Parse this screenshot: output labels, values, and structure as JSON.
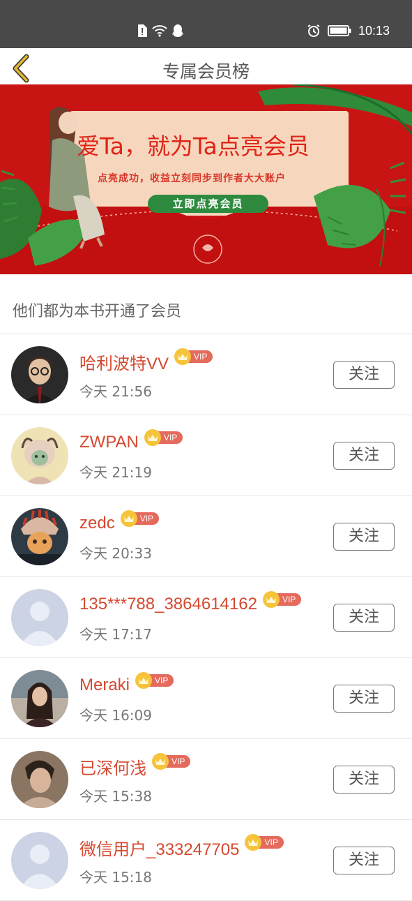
{
  "status_bar": {
    "time": "10:13",
    "icons": [
      "sim-alert-icon",
      "wifi-icon",
      "qq-icon",
      "alarm-icon",
      "battery-icon"
    ]
  },
  "header": {
    "title": "专属会员榜",
    "back_icon": "chevron-left-icon"
  },
  "banner": {
    "title": "爱Ta，就为Ta点亮会员",
    "subtitle": "点亮成功，收益立刻同步到作者大大账户",
    "button_label": "立即点亮会员",
    "background_color": "#c91414",
    "accent_color": "#2d8a3e"
  },
  "section": {
    "heading": "他们都为本书开通了会员"
  },
  "vip_label": "VIP",
  "follow_label": "关注",
  "members": [
    {
      "name": "哈利波特VV",
      "time": "今天 21:56",
      "avatar": "avatar-photo-boy-glasses"
    },
    {
      "name": "ZWPAN",
      "time": "今天 21:19",
      "avatar": "avatar-cartoon-character"
    },
    {
      "name": "zedc",
      "time": "今天 20:33",
      "avatar": "avatar-cat-costume"
    },
    {
      "name": "135***788_3864614162",
      "time": "今天 17:17",
      "avatar": "avatar-default"
    },
    {
      "name": "Meraki",
      "time": "今天 16:09",
      "avatar": "avatar-photo-woman"
    },
    {
      "name": "已深何浅",
      "time": "今天 15:38",
      "avatar": "avatar-photo-man"
    },
    {
      "name": "微信用户_333247705",
      "time": "今天 15:18",
      "avatar": "avatar-default"
    }
  ],
  "colors": {
    "name_color": "#d5492f",
    "vip_crown": "#f6c43a",
    "vip_tag": "#e46a5c"
  }
}
